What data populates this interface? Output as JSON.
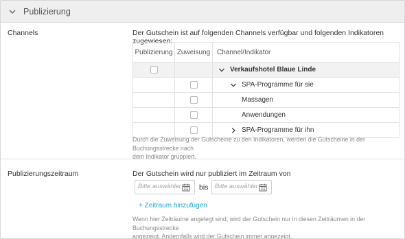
{
  "section": {
    "title": "Publizierung"
  },
  "channels": {
    "label": "Channels",
    "intro": "Der Gutschein ist auf folgenden Channels verfügbar und folgenden Indikatoren zugewiesen:",
    "columns": [
      "Publizierung",
      "Zuweisung",
      "Channel/Indikator"
    ],
    "rows": [
      {
        "name": "Verkaufshotel Blaue Linde",
        "level": 0,
        "expanded": true,
        "publizierung_checkbox": true,
        "zuweisung_checkbox": false
      },
      {
        "name": "SPA-Programme für sie",
        "level": 1,
        "expanded": true,
        "publizierung_checkbox": false,
        "zuweisung_checkbox": true
      },
      {
        "name": "Massagen",
        "level": 2,
        "publizierung_checkbox": false,
        "zuweisung_checkbox": true
      },
      {
        "name": "Anwendungen",
        "level": 2,
        "publizierung_checkbox": false,
        "zuweisung_checkbox": true
      },
      {
        "name": "SPA-Programme für ihn",
        "level": 1,
        "expanded": false,
        "publizierung_checkbox": false,
        "zuweisung_checkbox": true
      }
    ],
    "help_line1": "Durch die Zuweisung der Gutscheine zu den Indikatoren, werden die Gutscheine in der Buchungsstrecke nach",
    "help_line2": "dem Indikator gruppiert."
  },
  "zeitraum": {
    "label": "Publizierungszeitraum",
    "intro": "Der Gutschein wird nur publiziert im Zeitraum von",
    "from_placeholder": "Bitte auswählen",
    "to_placeholder": "Bitte auswählen",
    "bis": "bis",
    "add_link": "+ Zeitraum hinzufügen",
    "help_line1": "Wenn hier Zeiträume angelegt sind, wird der Gutschein nur in diesen Zeiträumen in der Buchungsstrecke",
    "help_line2": "angezeigt. Andernfalls wird der Gutschein immer angezeigt."
  },
  "colors": {
    "accent_link": "#1ea1d9",
    "header_bg": "#efefef",
    "help_text": "#8a8a8a"
  }
}
